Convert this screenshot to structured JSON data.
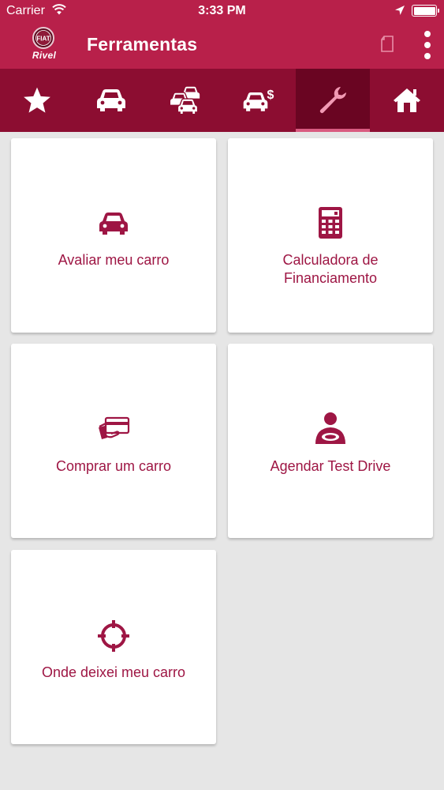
{
  "status_bar": {
    "carrier": "Carrier",
    "time": "3:33 PM"
  },
  "app_bar": {
    "logo_text": "Rivel",
    "title": "Ferramentas"
  },
  "tabs": [
    {
      "name": "favorites",
      "icon": "star-icon",
      "active": false
    },
    {
      "name": "new-cars",
      "icon": "car-icon",
      "active": false
    },
    {
      "name": "used-cars",
      "icon": "cars-icon",
      "active": false
    },
    {
      "name": "car-sales",
      "icon": "car-dollar-icon",
      "active": false
    },
    {
      "name": "tools",
      "icon": "wrench-icon",
      "active": true
    },
    {
      "name": "home",
      "icon": "home-icon",
      "active": false
    }
  ],
  "cards": {
    "evaluate": {
      "label_line1": "Avaliar meu carro",
      "icon": "car-icon"
    },
    "calculator": {
      "label_line1": "Calculadora de",
      "label_line2": "Financiamento",
      "icon": "calculator-icon"
    },
    "buy": {
      "label_line1": "Comprar um carro",
      "icon": "card-payment-icon"
    },
    "test_drive": {
      "label_line1": "Agendar Test Drive",
      "icon": "driver-icon"
    },
    "find_car": {
      "label_line1": "Onde deixei meu carro",
      "icon": "crosshair-icon"
    }
  },
  "colors": {
    "header": "#b8204a",
    "tab_bar": "#8c0d31",
    "tab_active": "#6a0522",
    "accent": "#9e1644",
    "background": "#e6e6e6"
  }
}
